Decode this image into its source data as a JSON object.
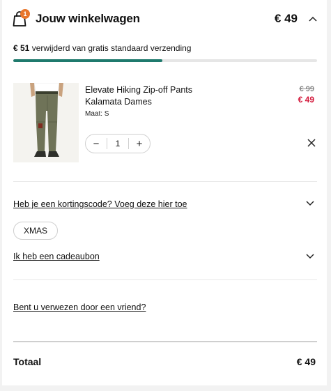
{
  "header": {
    "title": "Jouw winkelwagen",
    "badge_count": "1",
    "total": "€ 49",
    "bag_icon": "shopping-bag-icon",
    "collapse_icon": "chevron-up-icon",
    "badge_color": "#e8762b"
  },
  "shipping": {
    "amount": "€ 51",
    "message": " verwijderd van gratis standaard verzending",
    "progress_fraction": 0.49,
    "progress_color": "#1f7a6d"
  },
  "item": {
    "name_line1": "Elevate Hiking Zip-off Pants",
    "name_line2": "Kalamata Dames",
    "size": "Maat: S",
    "price_old": "€ 99",
    "price_new": "€ 49",
    "price_new_color": "#d3173a",
    "quantity": "1",
    "decrement_label": "−",
    "increment_label": "+",
    "remove_icon": "close-icon"
  },
  "discount": {
    "link": "Heb je een kortingscode? Voeg deze hier toe",
    "applied_code": "XMAS"
  },
  "giftcard": {
    "link": "Ik heb een cadeaubon"
  },
  "referral": {
    "link": "Bent u verwezen door een vriend?"
  },
  "totals": {
    "label": "Totaal",
    "value": "€ 49"
  }
}
